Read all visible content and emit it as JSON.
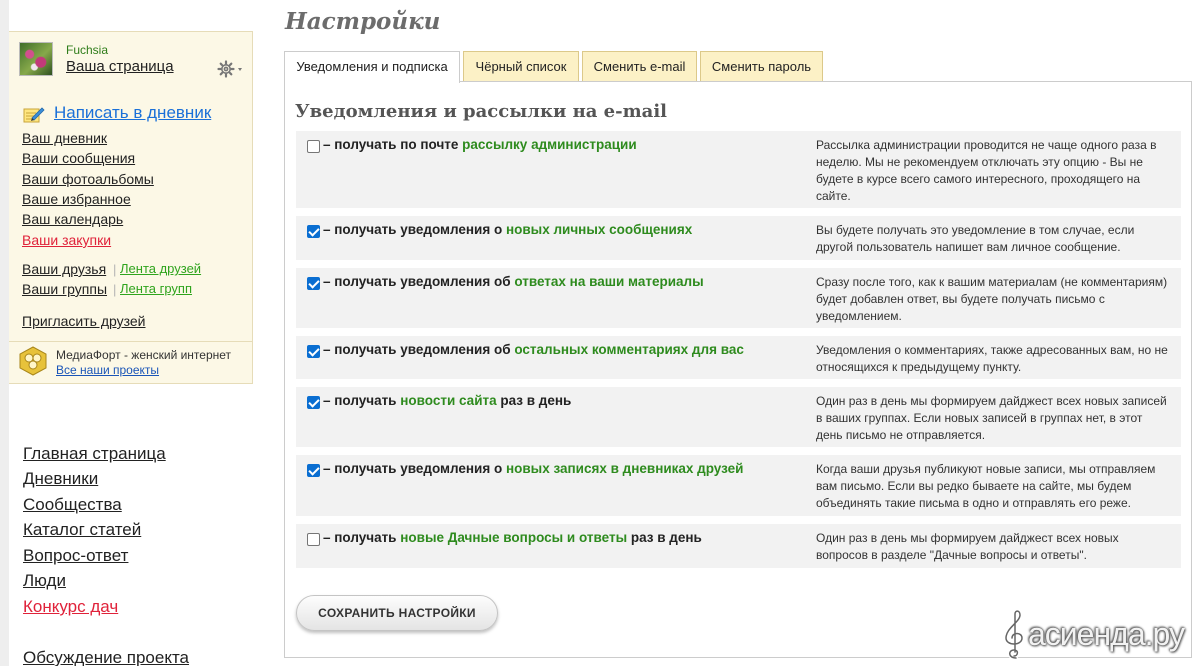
{
  "user": {
    "name": "Fuchsia",
    "my_page": "Ваша страница",
    "write_diary": "Написать в дневник"
  },
  "sidebar": {
    "menu": [
      "Ваш дневник",
      "Ваши сообщения",
      "Ваши фотоальбомы",
      "Ваше избранное",
      "Ваш календарь",
      "Ваши закупки"
    ],
    "friends": "Ваши друзья",
    "friends_feed": "Лента друзей",
    "groups": "Ваши группы",
    "groups_feed": "Лента групп",
    "pipe": "|",
    "invite": "Пригласить друзей",
    "mediafort_text": "МедиаФорт - женский интернет",
    "mediafort_link": "Все наши проекты"
  },
  "site_nav": [
    "Главная страница",
    "Дневники",
    "Сообщества",
    "Каталог статей",
    "Вопрос-ответ",
    "Люди",
    "Конкурс дач",
    "Обсуждение проекта"
  ],
  "page": {
    "title": "Настройки",
    "tabs": [
      "Уведомления и подписка",
      "Чёрный список",
      "Сменить e-mail",
      "Сменить пароль"
    ],
    "active_tab": "Уведомления и подписка",
    "section_title": "Уведомления и рассылки на e-mail",
    "save_button": "СОХРАНИТЬ НАСТРОЙКИ"
  },
  "options": [
    {
      "checked": false,
      "prefix": "– получать по почте ",
      "highlight": "рассылку администрации",
      "suffix": "",
      "description": "Рассылка администрации проводится не чаще одного раза в неделю. Мы не рекомендуем отключать эту опцию - Вы не будете в курсе всего самого интересного, проходящего на сайте."
    },
    {
      "checked": true,
      "prefix": "– получать уведомления о ",
      "highlight": "новых личных сообщениях",
      "suffix": "",
      "description": "Вы будете получать это уведомление в том случае, если другой пользователь напишет вам личное сообщение."
    },
    {
      "checked": true,
      "prefix": "– получать уведомления об ",
      "highlight": "ответах на ваши материалы",
      "suffix": "",
      "description": "Сразу после того, как к вашим материалам (не комментариям) будет добавлен ответ, вы будете получать письмо с уведомлением."
    },
    {
      "checked": true,
      "prefix": "– получать уведомления об ",
      "highlight": "остальных комментариях для вас",
      "suffix": "",
      "description": "Уведомления о комментариях, также адресованных вам, но не относящихся к предыдущему пункту."
    },
    {
      "checked": true,
      "prefix": "– получать ",
      "highlight": "новости сайта",
      "suffix": " раз в день",
      "description": "Один раз в день мы формируем дайджест всех новых записей в ваших группах. Если новых записей в группах нет, в этот день письмо не отправляется."
    },
    {
      "checked": true,
      "prefix": "– получать уведомления о ",
      "highlight": "новых записях в дневниках друзей",
      "suffix": "",
      "description": "Когда ваши друзья публикуют новые записи, мы отправляем вам письмо. Если вы редко бываете на сайте, мы будем объединять такие письма в одно и отправлять его реже."
    },
    {
      "checked": false,
      "prefix": "– получать ",
      "highlight": "новые Дачные вопросы и ответы",
      "suffix": " раз в день",
      "description": "Один раз в день мы формируем дайджест всех новых вопросов в разделе \"Дачные вопросы и ответы\"."
    }
  ],
  "watermark": "асиенда.ру",
  "colors": {
    "accent_green": "#2e8b1e",
    "link_blue": "#1a70d8",
    "link_red": "#e0223a",
    "tab_bg": "#fcf1c6",
    "sidebar_bg": "#fcf8e6",
    "row_bg": "#f2f2f2",
    "checkbox_blue": "#0a6ed1"
  },
  "icons": {
    "gear": "gear-icon",
    "pencil": "pencil-notepad-icon",
    "mediafort": "mediafort-logo-icon",
    "checkbox": "checkbox-icon"
  }
}
